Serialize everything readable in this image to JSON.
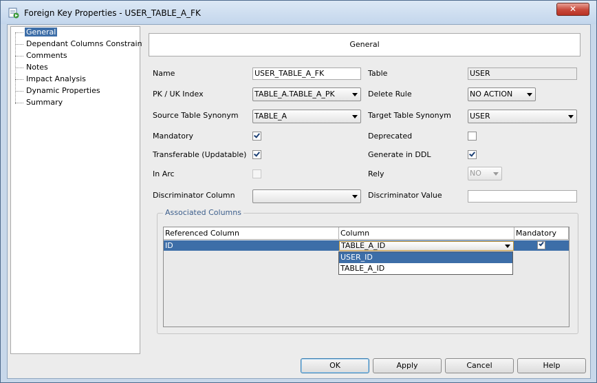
{
  "window": {
    "title": "Foreign Key Properties - USER_TABLE_A_FK",
    "close_glyph": "✕"
  },
  "nav_tree": {
    "items": [
      {
        "label": "General",
        "selected": true
      },
      {
        "label": "Dependant Columns Constraint",
        "selected": false
      },
      {
        "label": "Comments",
        "selected": false
      },
      {
        "label": "Notes",
        "selected": false
      },
      {
        "label": "Impact Analysis",
        "selected": false
      },
      {
        "label": "Dynamic Properties",
        "selected": false
      },
      {
        "label": "Summary",
        "selected": false
      }
    ]
  },
  "panel": {
    "header": "General",
    "name_label": "Name",
    "name_value": "USER_TABLE_A_FK",
    "table_label": "Table",
    "table_value": "USER",
    "pk_uk_label": "PK / UK Index",
    "pk_uk_value": "TABLE_A.TABLE_A_PK",
    "delete_rule_label": "Delete Rule",
    "delete_rule_value": "NO ACTION",
    "source_synonym_label": "Source Table Synonym",
    "source_synonym_value": "TABLE_A",
    "target_synonym_label": "Target Table Synonym",
    "target_synonym_value": "USER",
    "mandatory_label": "Mandatory",
    "mandatory_checked": true,
    "deprecated_label": "Deprecated",
    "deprecated_checked": false,
    "transferable_label": "Transferable (Updatable)",
    "transferable_checked": true,
    "generate_ddl_label": "Generate in DDL",
    "generate_ddl_checked": true,
    "in_arc_label": "In Arc",
    "in_arc_checked": false,
    "rely_label": "Rely",
    "rely_value": "NO",
    "discriminator_column_label": "Discriminator Column",
    "discriminator_column_value": "",
    "discriminator_value_label": "Discriminator Value",
    "discriminator_value_value": ""
  },
  "associated_columns": {
    "title": "Associated Columns",
    "headers": [
      "Referenced Column",
      "Column",
      "Mandatory"
    ],
    "rows": [
      {
        "referenced": "ID",
        "column": "TABLE_A_ID",
        "mandatory": true
      }
    ],
    "dropdown_options": [
      "USER_ID",
      "TABLE_A_ID"
    ],
    "dropdown_highlighted": "USER_ID"
  },
  "buttons": {
    "ok": "OK",
    "apply": "Apply",
    "cancel": "Cancel",
    "help": "Help"
  },
  "colors": {
    "selection": "#3d6ea8",
    "group_title": "#3d5f8c",
    "close_button": "#c7483a"
  }
}
